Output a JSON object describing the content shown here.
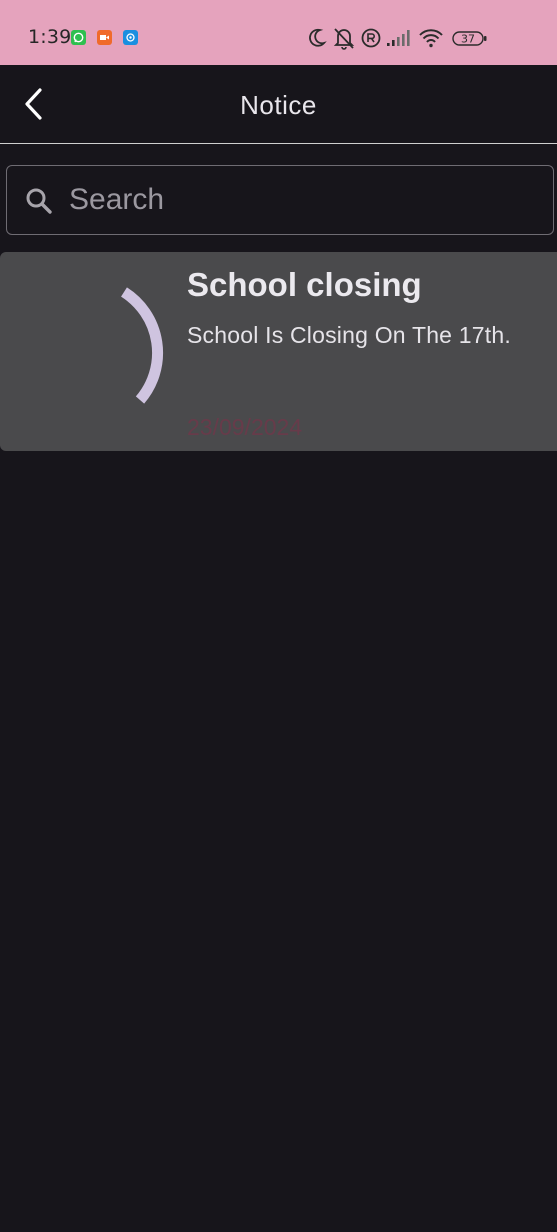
{
  "status_bar": {
    "time": "1:39",
    "battery_level": "37",
    "notification_icons": [
      "whatsapp-icon",
      "video-recorder-icon",
      "app-notification-icon"
    ],
    "system_icons": [
      "moon-icon",
      "bell-off-icon",
      "registered-icon",
      "signal-icon",
      "wifi-icon",
      "battery-icon"
    ],
    "color": "#e5a3bd"
  },
  "header": {
    "title": "Notice",
    "back_icon": "chevron-left-icon"
  },
  "search": {
    "placeholder": "Search",
    "value": "",
    "icon": "search-icon"
  },
  "notices": [
    {
      "title": "School closing",
      "body": "School Is Closing On The 17th.",
      "date": "23/09/2024",
      "loading_icon": "loading-spinner-icon"
    }
  ],
  "colors": {
    "background": "#17151b",
    "card": "#4a4a4c",
    "spinner": "#cfc4e0",
    "date_text": "#6b3a4a"
  }
}
